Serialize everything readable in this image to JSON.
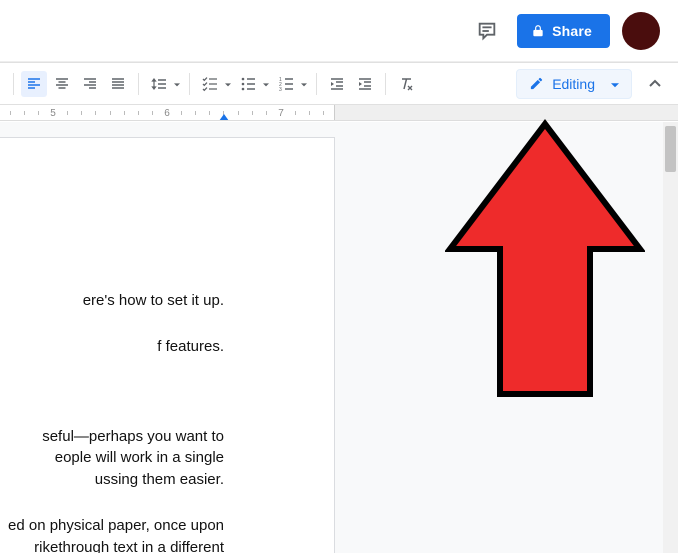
{
  "header": {
    "share_label": "Share"
  },
  "toolbar": {
    "mode_label": "Editing"
  },
  "ruler": {
    "ticks": [
      "5",
      "6",
      "7"
    ]
  },
  "document": {
    "lines": [
      "ere's how to set it up.",
      "f features.",
      "seful—perhaps you want to",
      "eople will work in a single",
      "ussing them easier.",
      "ed on physical paper, once upon",
      "rikethrough text in a different"
    ]
  }
}
